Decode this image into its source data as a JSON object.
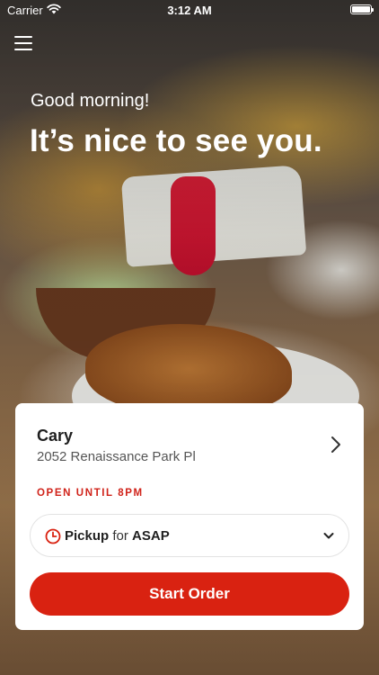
{
  "status_bar": {
    "carrier": "Carrier",
    "time": "3:12 AM"
  },
  "greeting": "Good morning!",
  "headline": "It’s nice to see you.",
  "location": {
    "name": "Cary",
    "address": "2052 Renaissance Park Pl",
    "open_status": "OPEN UNTIL 8PM"
  },
  "order_mode": {
    "method": "Pickup",
    "connector": "for",
    "time": "ASAP"
  },
  "start_order_label": "Start Order",
  "colors": {
    "accent": "#d92211",
    "status_red": "#d0231a"
  },
  "icons": {
    "menu": "hamburger-menu-icon",
    "wifi": "wifi-icon",
    "battery": "battery-icon",
    "location_chevron": "chevron-right-icon",
    "clock": "clock-icon",
    "dropdown": "chevron-down-icon"
  }
}
